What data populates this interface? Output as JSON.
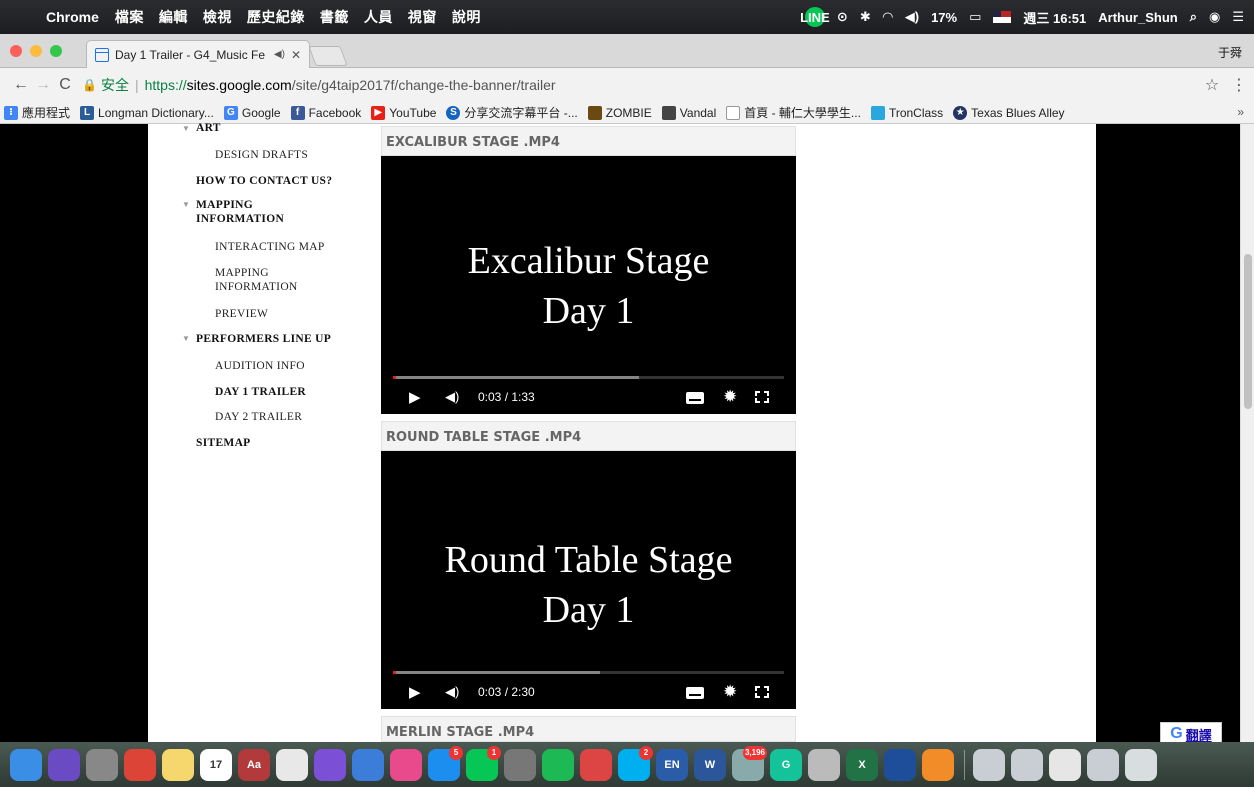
{
  "menubar": {
    "app_name": "Chrome",
    "menus": [
      "檔案",
      "編輯",
      "檢視",
      "歷史紀錄",
      "書籤",
      "人員",
      "視窗",
      "說明"
    ],
    "battery": "17%",
    "datetime": "週三 16:51",
    "user": "Arthur_Shun"
  },
  "tab": {
    "title": "Day 1 Trailer - G4_Music Fe",
    "profile_name": "于舜"
  },
  "omnibox": {
    "secure_label": "安全",
    "separator": "|",
    "scheme": "https://",
    "host": "sites.google.com",
    "path": "/site/g4taip2017f/change-the-banner/trailer"
  },
  "bookmarks": [
    {
      "label": "應用程式",
      "color": "#4285f4"
    },
    {
      "label": "Longman Dictionary...",
      "color": "#2a5c9a"
    },
    {
      "label": "Google",
      "color": "#4285f4"
    },
    {
      "label": "Facebook",
      "color": "#3b5998"
    },
    {
      "label": "YouTube",
      "color": "#e62117"
    },
    {
      "label": "分享交流字幕平台 -...",
      "color": "#1565c0"
    },
    {
      "label": "ZOMBIE",
      "color": "#6b4a12"
    },
    {
      "label": "Vandal",
      "color": "#444444"
    },
    {
      "label": "首頁 - 輔仁大學學生...",
      "color": "#888888"
    },
    {
      "label": "TronClass",
      "color": "#2aa7de"
    },
    {
      "label": "Texas Blues Alley",
      "color": "#223366"
    }
  ],
  "sidebar": {
    "items": [
      {
        "label": "ART",
        "bold": true,
        "caret": true
      },
      {
        "label": "DESIGN DRAFTS",
        "bold": false
      },
      {
        "label": "HOW TO CONTACT US?",
        "bold": true
      },
      {
        "label": "MAPPING INFORMATION",
        "bold": true,
        "caret": true
      },
      {
        "label": "INTERACTING MAP",
        "bold": false
      },
      {
        "label": "MAPPING INFORMATION",
        "bold": false
      },
      {
        "label": "PREVIEW",
        "bold": false
      },
      {
        "label": "PERFORMERS LINE UP",
        "bold": true,
        "caret": true
      },
      {
        "label": "AUDITION INFO",
        "bold": false
      },
      {
        "label": "DAY 1 TRAILER",
        "bold": true
      },
      {
        "label": "DAY 2 TRAILER",
        "bold": false
      },
      {
        "label": "SITEMAP",
        "bold": true
      }
    ]
  },
  "videos": [
    {
      "file": "EXCALIBUR STAGE .MP4",
      "title_line1": "Excalibur Stage",
      "title_line2": "Day 1",
      "time": "0:03 / 1:33",
      "progress": 0.008,
      "buffered": 0.63
    },
    {
      "file": "ROUND TABLE STAGE .MP4",
      "title_line1": "Round Table Stage",
      "title_line2": "Day 1",
      "time": "0:03 / 2:30",
      "progress": 0.008,
      "buffered": 0.53
    },
    {
      "file": "MERLIN STAGE .MP4"
    }
  ],
  "translate": {
    "g": "G",
    "label": "翻譯"
  },
  "dock": {
    "icons": [
      {
        "name": "finder-icon",
        "color": "#3a8ee6"
      },
      {
        "name": "siri-icon",
        "color": "#6a4bc4"
      },
      {
        "name": "launchpad-icon",
        "color": "#888888"
      },
      {
        "name": "chrome-icon",
        "color": "#db4437"
      },
      {
        "name": "notes-icon",
        "color": "#f5d76e"
      },
      {
        "name": "calendar-icon",
        "color": "#ffffff",
        "text": "17"
      },
      {
        "name": "dictionary-icon",
        "color": "#b23a3a",
        "text": "Aa"
      },
      {
        "name": "textedit-icon",
        "color": "#e8e8e8"
      },
      {
        "name": "imovie-icon",
        "color": "#7b4fd6"
      },
      {
        "name": "keynote-icon",
        "color": "#3b7dd8"
      },
      {
        "name": "itunes-icon",
        "color": "#e84a8b"
      },
      {
        "name": "appstore-icon",
        "color": "#1b8ef0",
        "badge": "5"
      },
      {
        "name": "line-icon",
        "color": "#06c755",
        "badge": "1"
      },
      {
        "name": "system-preferences-icon",
        "color": "#777777"
      },
      {
        "name": "spotify-icon",
        "color": "#1db954"
      },
      {
        "name": "popcorn-icon",
        "color": "#d44"
      },
      {
        "name": "skype-icon",
        "color": "#00aff0",
        "badge": "2"
      },
      {
        "name": "language-icon",
        "color": "#2a5caa",
        "text": "EN"
      },
      {
        "name": "word-icon",
        "color": "#2b579a",
        "text": "W"
      },
      {
        "name": "preview-icon",
        "color": "#8aa",
        "badge": "3,196"
      },
      {
        "name": "grammarly-icon",
        "color": "#15c39a",
        "text": "G"
      },
      {
        "name": "disk-utility-icon",
        "color": "#bbbbbb"
      },
      {
        "name": "excel-icon",
        "color": "#217346",
        "text": "X"
      },
      {
        "name": "quicktime-icon",
        "color": "#1e4d9a"
      },
      {
        "name": "audacity-icon",
        "color": "#f28c28"
      },
      {
        "name": "window-thumbnail-icon-1",
        "color": "#c9ced4",
        "separator": true
      },
      {
        "name": "window-thumbnail-icon-2",
        "color": "#c9ced4"
      },
      {
        "name": "window-thumbnail-icon-3",
        "color": "#e6e6e6"
      },
      {
        "name": "window-thumbnail-icon-4",
        "color": "#c9ced4"
      },
      {
        "name": "trash-icon",
        "color": "#d8dde0"
      }
    ]
  }
}
